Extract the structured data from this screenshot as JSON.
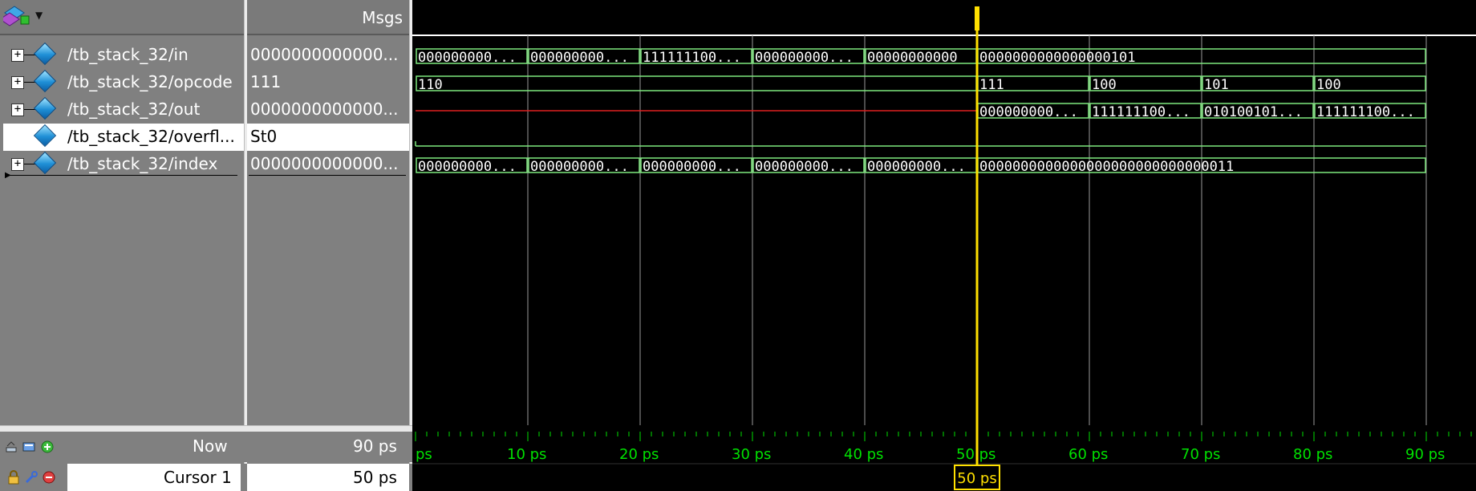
{
  "names_header": {
    "icon": "wave-window-icon"
  },
  "msgs_header": {
    "label": "Msgs"
  },
  "signals": [
    {
      "name": "/tb_stack_32/in",
      "value": "0000000000000...",
      "expandable": true
    },
    {
      "name": "/tb_stack_32/opcode",
      "value": "111",
      "expandable": true
    },
    {
      "name": "/tb_stack_32/out",
      "value": "0000000000000...",
      "expandable": true
    },
    {
      "name": "/tb_stack_32/overfl...",
      "value": "St0",
      "expandable": false,
      "selected": true
    },
    {
      "name": "/tb_stack_32/index",
      "value": "0000000000000...",
      "expandable": true
    }
  ],
  "waves": {
    "in": [
      "000000000...",
      "000000000...",
      "111111100...",
      "000000000...",
      "00000000000",
      "0000000000000000101"
    ],
    "opcode": [
      "110",
      "111",
      "100",
      "101",
      "100"
    ],
    "out": [
      "000000000...",
      "111111100...",
      "010100101...",
      "111111100..."
    ],
    "index": [
      "000000000...",
      "000000000...",
      "000000000...",
      "000000000...",
      "000000000...",
      "0000000000000000000000000000011"
    ]
  },
  "status": {
    "now_label": "Now",
    "now_value": "90 ps",
    "cursor_label": "Cursor 1",
    "cursor_value": "50 ps",
    "cursor_marker": "50 ps"
  },
  "timeline": {
    "labels": [
      "ps",
      "10 ps",
      "20 ps",
      "30 ps",
      "40 ps",
      "50 ps",
      "60 ps",
      "70 ps",
      "80 ps",
      "90 ps"
    ]
  },
  "colors": {
    "wave_green": "#7ee87e",
    "wave_red": "#e02020",
    "cursor_yellow": "#ffe000",
    "grid": "#9a9a9a",
    "timeline_text": "#00e000"
  },
  "icons": [
    "add-wave-icon",
    "zoom-icon",
    "insert-cursor-icon",
    "lock-icon",
    "wrench-icon",
    "remove-cursor-icon"
  ]
}
